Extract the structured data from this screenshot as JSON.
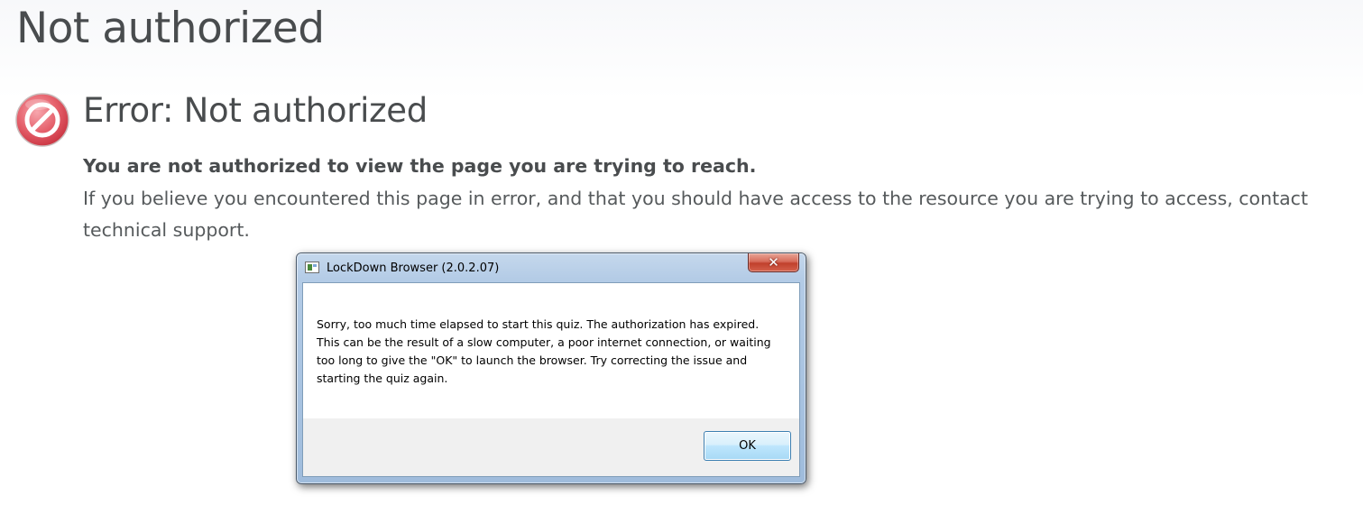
{
  "page": {
    "title": "Not authorized"
  },
  "error": {
    "icon": "no-entry-icon",
    "heading": "Error: Not authorized",
    "strong_message": "You are not authorized to view the page you are trying to reach.",
    "detail_message": "If you believe you encountered this page in error, and that you should have access to the resource you are trying to access, contact technical support."
  },
  "dialog": {
    "title": "LockDown Browser (2.0.2.07)",
    "app_icon": "application-window-icon",
    "close_icon": "close-icon",
    "close_symbol": "✕",
    "message": "Sorry, too much time elapsed to start this quiz. The authorization has expired. This can be the result of a slow computer, a poor internet connection, or waiting too long to give the \"OK\" to launch the browser. Try correcting the issue and starting the quiz again.",
    "ok_label": "OK"
  },
  "colors": {
    "text": "#494c4e",
    "error_icon": "#e0505a",
    "dialog_frame": "#b3cbe6",
    "close_button": "#c0402c"
  }
}
